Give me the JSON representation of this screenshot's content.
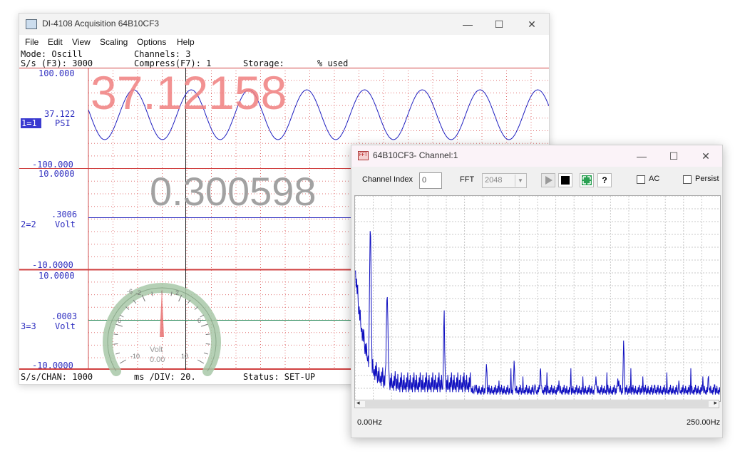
{
  "main_window": {
    "title": "DI-4108 Acquisition 64B10CF3",
    "controls": {
      "minimize": "—",
      "maximize": "☐",
      "close": "✕"
    },
    "menu": [
      "File",
      "Edit",
      "View",
      "Scaling",
      "Options",
      "Help"
    ],
    "header": {
      "mode": "Mode: Oscill",
      "channels": "Channels: 3",
      "sps": "S/s (F3): 3000",
      "compress": "Compress(F7): 1",
      "storage": "Storage:",
      "used": "% used"
    },
    "channels": [
      {
        "top": "100.000",
        "bottom": "-100.000",
        "value": "37.122",
        "id": "1=1",
        "unit": "PSI",
        "big_readout": "37.12158"
      },
      {
        "top": "10.0000",
        "bottom": "-10.0000",
        "value": ".3006",
        "id": "2=2",
        "unit": "Volt",
        "big_readout": "0.300598"
      },
      {
        "top": "10.0000",
        "bottom": "-10.0000",
        "value": ".0003",
        "id": "3=3",
        "unit": "Volt"
      }
    ],
    "gauge": {
      "ticks": [
        "-10",
        "-6",
        "-2",
        "2",
        "6",
        "10"
      ],
      "unit": "Volt",
      "value": "0.00"
    },
    "footer": {
      "sps_chan": "S/s/CHAN: 1000",
      "ms_div": "ms /DIV: 20.",
      "status": "Status: SET-UP"
    },
    "colors": {
      "grid": "#d05050",
      "trace": "#2020c0",
      "readout_red": "#f08080",
      "readout_gray": "#999999"
    }
  },
  "fft_window": {
    "title": "64B10CF3- Channel:1",
    "controls": {
      "minimize": "—",
      "maximize": "☐",
      "close": "✕"
    },
    "channel_index_label": "Channel Index",
    "channel_index_value": "0",
    "fft_label": "FFT",
    "fft_size": "2048",
    "help_label": "?",
    "ac_label": "AC",
    "persist_label": "Persist",
    "x_start": "0.00Hz",
    "x_end": "250.00Hz"
  },
  "chart_data": {
    "type": "line",
    "x_range": [
      0,
      250
    ],
    "xlabel_start": "0.00Hz",
    "xlabel_end": "250.00Hz",
    "grid": true,
    "peaks": [
      {
        "x": 0,
        "y": 0.62
      },
      {
        "x": 10.5,
        "y": 0.85
      },
      {
        "x": 22,
        "y": 0.52
      },
      {
        "x": 61,
        "y": 0.45
      },
      {
        "x": 90,
        "y": 0.18
      },
      {
        "x": 109,
        "y": 0.2
      },
      {
        "x": 127,
        "y": 0.17
      },
      {
        "x": 165,
        "y": 0.12
      },
      {
        "x": 180,
        "y": 0.11
      },
      {
        "x": 184,
        "y": 0.3
      },
      {
        "x": 242,
        "y": 0.13
      }
    ]
  }
}
